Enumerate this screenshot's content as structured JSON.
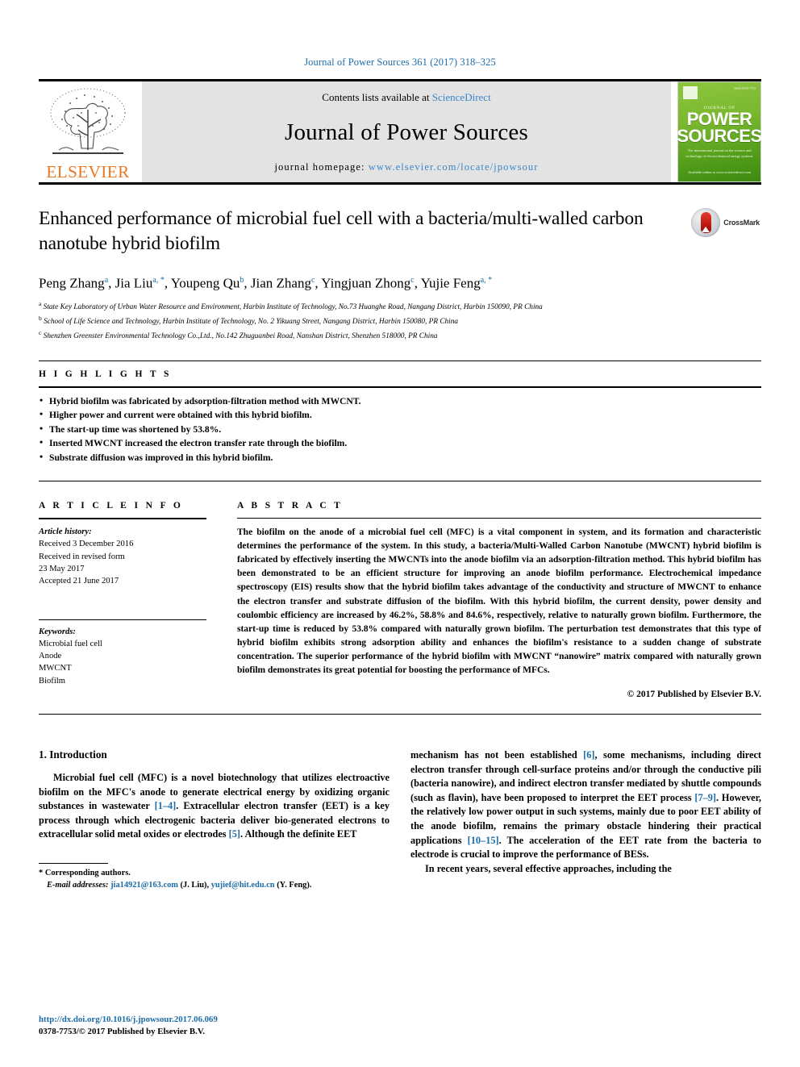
{
  "running_head": "Journal of Power Sources 361 (2017) 318–325",
  "masthead": {
    "publisher_name": "ELSEVIER",
    "contents_prefix": "Contents lists available at",
    "contents_link": "ScienceDirect",
    "journal_name": "Journal of Power Sources",
    "homepage_prefix": "journal homepage:",
    "homepage_url": "www.elsevier.com/locate/jpowsour",
    "cover": {
      "kicker": "JOURNAL OF",
      "title_line1": "POWER",
      "title_line2": "SOURCES",
      "description": "The international journal on the science and technology of electrochemical energy systems",
      "footer": "Available online at\nwww.sciencedirect.com"
    }
  },
  "article": {
    "title": "Enhanced performance of microbial fuel cell with a bacteria/multi-walled carbon nanotube hybrid biofilm",
    "crossmark_label": "CrossMark",
    "authors": [
      {
        "name": "Peng Zhang",
        "sup": "a"
      },
      {
        "name": "Jia Liu",
        "sup": "a, *"
      },
      {
        "name": "Youpeng Qu",
        "sup": "b"
      },
      {
        "name": "Jian Zhang",
        "sup": "c"
      },
      {
        "name": "Yingjuan Zhong",
        "sup": "c"
      },
      {
        "name": "Yujie Feng",
        "sup": "a, *"
      }
    ],
    "affiliations": [
      {
        "mark": "a",
        "text": "State Key Laboratory of Urban Water Resource and Environment, Harbin Institute of Technology, No.73 Huanghe Road, Nangang District, Harbin 150090, PR China"
      },
      {
        "mark": "b",
        "text": "School of Life Science and Technology, Harbin Institute of Technology, No. 2 Yikuang Street, Nangang District, Harbin 150080, PR China"
      },
      {
        "mark": "c",
        "text": "Shenzhen Greenster Environmental Technology Co.,Ltd., No.142 Zhuguanbei Road, Nanshan District, Shenzhen 518000, PR China"
      }
    ]
  },
  "highlights": {
    "heading": "H I G H L I G H T S",
    "items": [
      "Hybrid biofilm was fabricated by adsorption-filtration method with MWCNT.",
      "Higher power and current were obtained with this hybrid biofilm.",
      "The start-up time was shortened by 53.8%.",
      "Inserted MWCNT increased the electron transfer rate through the biofilm.",
      "Substrate diffusion was improved in this hybrid biofilm."
    ]
  },
  "article_info": {
    "heading": "A R T I C L E   I N F O",
    "history_label": "Article history:",
    "history_lines": [
      "Received 3 December 2016",
      "Received in revised form",
      "23 May 2017",
      "Accepted 21 June 2017"
    ],
    "keywords_label": "Keywords:",
    "keywords": [
      "Microbial fuel cell",
      "Anode",
      "MWCNT",
      "Biofilm"
    ]
  },
  "abstract": {
    "heading": "A B S T R A C T",
    "text": "The biofilm on the anode of a microbial fuel cell (MFC) is a vital component in system, and its formation and characteristic determines the performance of the system. In this study, a bacteria/Multi-Walled Carbon Nanotube (MWCNT) hybrid biofilm is fabricated by effectively inserting the MWCNTs into the anode biofilm via an adsorption-filtration method. This hybrid biofilm has been demonstrated to be an efficient structure for improving an anode biofilm performance. Electrochemical impedance spectroscopy (EIS) results show that the hybrid biofilm takes advantage of the conductivity and structure of MWCNT to enhance the electron transfer and substrate diffusion of the biofilm. With this hybrid biofilm, the current density, power density and coulombic efficiency are increased by 46.2%, 58.8% and 84.6%, respectively, relative to naturally grown biofilm. Furthermore, the start-up time is reduced by 53.8% compared with naturally grown biofilm. The perturbation test demonstrates that this type of hybrid biofilm exhibits strong adsorption ability and enhances the biofilm's resistance to a sudden change of substrate concentration. The superior performance of the hybrid biofilm with MWCNT “nanowire” matrix compared with naturally grown biofilm demonstrates its great potential for boosting the performance of MFCs.",
    "copyright": "© 2017 Published by Elsevier B.V."
  },
  "body": {
    "section_number_title": "1.  Introduction",
    "left_paragraph_1_a": "Microbial fuel cell (MFC) is a novel biotechnology that utilizes electroactive biofilm on the MFC's anode to generate electrical energy by oxidizing organic substances in wastewater ",
    "left_ref_1": "[1–4]",
    "left_paragraph_1_b": ". Extracellular electron transfer (EET) is a key process through which electrogenic bacteria deliver bio-generated electrons to extracellular solid metal oxides or electrodes ",
    "left_ref_2": "[5]",
    "left_paragraph_1_c": ". Although the definite EET",
    "right_paragraph_1_a": "mechanism has not been established ",
    "right_ref_1": "[6]",
    "right_paragraph_1_b": ", some mechanisms, including direct electron transfer through cell-surface proteins and/or through the conductive pili (bacteria nanowire), and indirect electron transfer mediated by shuttle compounds (such as flavin), have been proposed to interpret the EET process ",
    "right_ref_2": "[7–9]",
    "right_paragraph_1_c": ". However, the relatively low power output in such systems, mainly due to poor EET ability of the anode biofilm, remains the primary obstacle hindering their practical applications ",
    "right_ref_3": "[10–15]",
    "right_paragraph_1_d": ". The acceleration of the EET rate from the bacteria to electrode is crucial to improve the performance of BESs.",
    "right_paragraph_2": "In recent years, several effective approaches, including the"
  },
  "footer": {
    "corresponding_mark": "*",
    "corresponding_label": "Corresponding authors.",
    "email_label": "E-mail addresses:",
    "email_1": "jia14921@163.com",
    "email_1_owner": " (J. Liu), ",
    "email_2": "yujief@hit.edu.cn",
    "email_2_owner": " (Y. Feng).",
    "doi_url": "http://dx.doi.org/10.1016/j.jpowsour.2017.06.069",
    "issn_line": "0378-7753/© 2017 Published by Elsevier B.V."
  },
  "colors": {
    "link_blue": "#1a6ca8",
    "elsevier_orange": "#E87722",
    "cover_green": "#7ab82f"
  }
}
